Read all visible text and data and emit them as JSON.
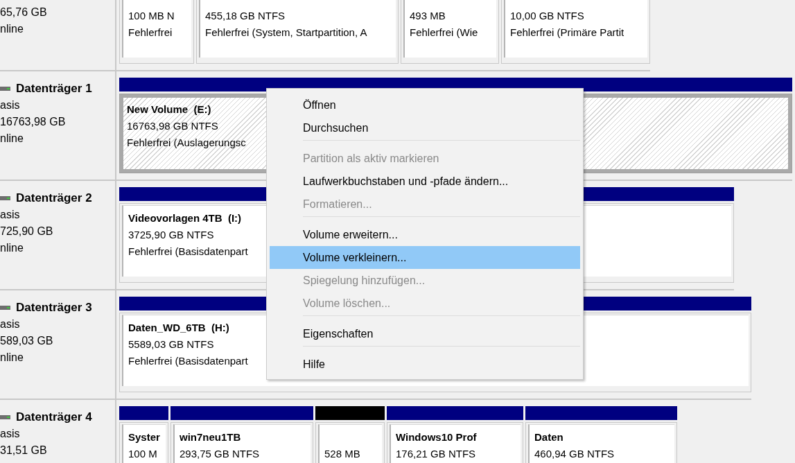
{
  "disks": [
    {
      "size": "65,76 GB",
      "status": "nline",
      "partitions": [
        {
          "size": "100 MB N",
          "status": "Fehlerfrei",
          "selected": false
        },
        {
          "size": "455,18 GB NTFS",
          "status": "Fehlerfrei (System, Startpartition, A",
          "selected": false
        },
        {
          "size": "493 MB",
          "status": "Fehlerfrei (Wie",
          "selected": false
        },
        {
          "size": "10,00 GB NTFS",
          "status": "Fehlerfrei (Primäre Partit",
          "selected": false
        }
      ]
    },
    {
      "name": "Datenträger 1",
      "type": "asis",
      "size": "16763,98 GB",
      "status": "nline",
      "partitions": [
        {
          "kind": "primary",
          "name": "New Volume  (E:)",
          "size": "16763,98 GB NTFS",
          "status": "Fehlerfrei (Auslagerungsc",
          "selected": true
        }
      ]
    },
    {
      "name": "Datenträger 2",
      "type": "asis",
      "size": "725,90 GB",
      "status": "nline",
      "partitions": [
        {
          "kind": "primary",
          "name": "Videovorlagen 4TB  (I:)",
          "size": "3725,90 GB NTFS",
          "status": "Fehlerfrei (Basisdatenpart",
          "selected": false
        }
      ]
    },
    {
      "name": "Datenträger 3",
      "type": "asis",
      "size": "589,03 GB",
      "status": "nline",
      "partitions": [
        {
          "kind": "primary",
          "name": "Daten_WD_6TB  (H:)",
          "size": "5589,03 GB NTFS",
          "status": "Fehlerfrei (Basisdatenpart",
          "selected": false
        }
      ]
    },
    {
      "name": "Datenträger 4",
      "type": "asis",
      "size": "31,51 GB",
      "partitions": [
        {
          "kind": "primary",
          "name": "Syster",
          "size": "100 M",
          "selected": false
        },
        {
          "kind": "primary",
          "name": "win7neu1TB",
          "size": "293,75 GB NTFS",
          "selected": false
        },
        {
          "kind": "unallocated",
          "size": "528 MB",
          "selected": false
        },
        {
          "kind": "primary",
          "name": "Windows10 Prof",
          "size": "176,21 GB NTFS",
          "selected": false
        },
        {
          "kind": "primary",
          "name": "Daten",
          "size": "460,94 GB NTFS",
          "selected": false
        }
      ]
    }
  ],
  "context_menu": {
    "items": [
      {
        "kind": "item",
        "label": "Öffnen",
        "disabled": false,
        "selected": false
      },
      {
        "kind": "item",
        "label": "Durchsuchen",
        "disabled": false,
        "selected": false
      },
      {
        "kind": "separator"
      },
      {
        "kind": "item",
        "label": "Partition als aktiv markieren",
        "disabled": true,
        "selected": false
      },
      {
        "kind": "item",
        "label": "Laufwerkbuchstaben und -pfade ändern...",
        "disabled": false,
        "selected": false
      },
      {
        "kind": "item",
        "label": "Formatieren...",
        "disabled": true,
        "selected": false
      },
      {
        "kind": "separator"
      },
      {
        "kind": "item",
        "label": "Volume erweitern...",
        "disabled": false,
        "selected": false
      },
      {
        "kind": "item",
        "label": "Volume verkleinern...",
        "disabled": false,
        "selected": true
      },
      {
        "kind": "item",
        "label": "Spiegelung hinzufügen...",
        "disabled": true,
        "selected": false
      },
      {
        "kind": "item",
        "label": "Volume löschen...",
        "disabled": true,
        "selected": false
      },
      {
        "kind": "separator"
      },
      {
        "kind": "item",
        "label": "Eigenschaften",
        "disabled": false,
        "selected": false
      },
      {
        "kind": "separator"
      },
      {
        "kind": "item",
        "label": "Hilfe",
        "disabled": false,
        "selected": false
      }
    ]
  }
}
